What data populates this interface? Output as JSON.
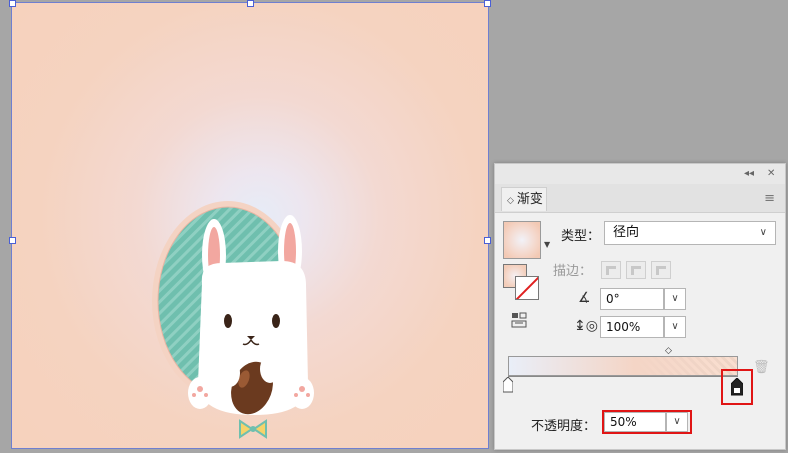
{
  "panel": {
    "collapse_icon": "◂◂",
    "close_icon": "✕",
    "tab_title": "渐变",
    "menu_icon": "≡",
    "type_label": "类型：",
    "type_value": "径向",
    "stroke_label": "描边：",
    "angle_value": "0°",
    "aspect_value": "100%",
    "opacity_label": "不透明度：",
    "opacity_value": "50%"
  },
  "icons": {
    "tab_chevron": "chevron-updown-icon",
    "dropdown": "chevron-down-icon",
    "trash": "trash-icon"
  },
  "colors": {
    "artboard_outer": "#f6d2bd",
    "artboard_center": "#e6ecf7",
    "highlight": "#e01515",
    "selection": "#4a5fd6"
  }
}
